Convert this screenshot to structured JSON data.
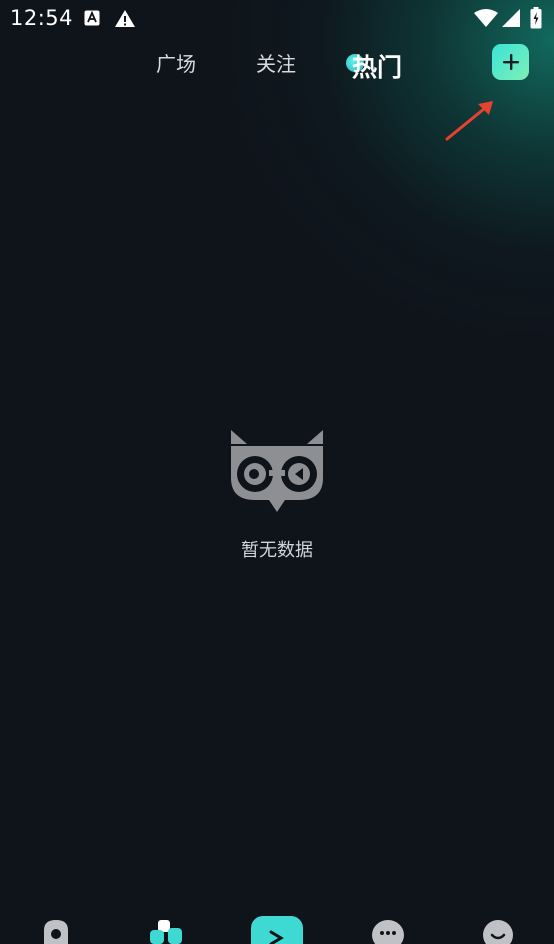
{
  "status_bar": {
    "time": "12:54",
    "icons": [
      "accessibility-a-icon",
      "warning-icon",
      "wifi-icon",
      "signal-icon",
      "battery-charging-icon"
    ]
  },
  "tabs": [
    {
      "label": "广场",
      "active": false
    },
    {
      "label": "关注",
      "active": false
    },
    {
      "label": "热门",
      "active": true
    }
  ],
  "add_button": {
    "icon": "plus-icon",
    "color_start": "#39e3d8",
    "color_end": "#7ff0b6"
  },
  "annotation": {
    "icon": "red-arrow-icon",
    "color": "#e8412f"
  },
  "empty_state": {
    "icon": "owl-icon",
    "text": "暂无数据"
  },
  "bottom_nav": {
    "items": [
      {
        "icon": "home-icon",
        "active": false
      },
      {
        "icon": "discover-icon",
        "active": false
      },
      {
        "icon": "play-icon",
        "active": true
      },
      {
        "icon": "message-icon",
        "active": false
      },
      {
        "icon": "profile-icon",
        "active": false
      }
    ],
    "accent_color": "#3fd9d4"
  },
  "colors": {
    "background": "#0f131a",
    "glow": "#127869"
  }
}
